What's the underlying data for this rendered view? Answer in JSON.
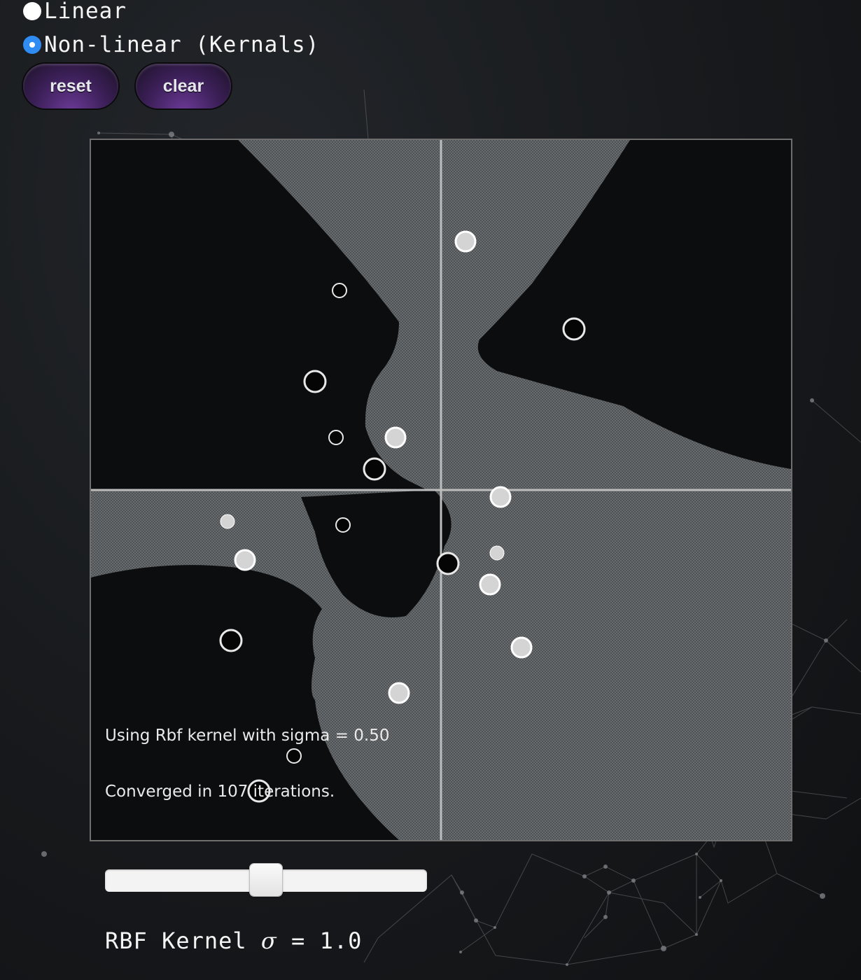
{
  "mode_options": [
    {
      "label": "Linear",
      "selected": false
    },
    {
      "label": "Non-linear (Kernals)",
      "selected": true
    }
  ],
  "buttons": {
    "reset_label": "reset",
    "clear_label": "clear"
  },
  "plot": {
    "kernel_text": "Using Rbf kernel with sigma = 0.50",
    "converged_text": "Converged in 107 iterations.",
    "colors": {
      "region_dark": "#0c0d0f",
      "region_light": "#575a5c",
      "axis": "#bdbdbd",
      "border": "#6e6e6e"
    },
    "points": [
      {
        "x": 0.07,
        "y": 0.71,
        "class": "positive",
        "size": "large"
      },
      {
        "x": -0.29,
        "y": 0.57,
        "class": "negative",
        "size": "small"
      },
      {
        "x": 0.38,
        "y": 0.46,
        "class": "negative",
        "size": "large"
      },
      {
        "x": -0.36,
        "y": 0.31,
        "class": "negative",
        "size": "large"
      },
      {
        "x": -0.3,
        "y": 0.15,
        "class": "negative",
        "size": "small"
      },
      {
        "x": -0.13,
        "y": 0.15,
        "class": "positive",
        "size": "large"
      },
      {
        "x": -0.19,
        "y": 0.06,
        "class": "negative",
        "size": "large"
      },
      {
        "x": 0.17,
        "y": -0.02,
        "class": "positive",
        "size": "large"
      },
      {
        "x": -0.61,
        "y": -0.09,
        "class": "positive",
        "size": "small"
      },
      {
        "x": -0.28,
        "y": -0.1,
        "class": "negative",
        "size": "small"
      },
      {
        "x": 0.16,
        "y": -0.18,
        "class": "positive",
        "size": "small"
      },
      {
        "x": -0.56,
        "y": -0.2,
        "class": "positive",
        "size": "large"
      },
      {
        "x": 0.02,
        "y": -0.21,
        "class": "negative",
        "size": "large"
      },
      {
        "x": 0.14,
        "y": -0.27,
        "class": "positive",
        "size": "large"
      },
      {
        "x": -0.6,
        "y": -0.43,
        "class": "negative",
        "size": "large"
      },
      {
        "x": 0.23,
        "y": -0.45,
        "class": "positive",
        "size": "large"
      },
      {
        "x": -0.12,
        "y": -0.58,
        "class": "positive",
        "size": "large"
      },
      {
        "x": -0.42,
        "y": -0.76,
        "class": "negative",
        "size": "small"
      },
      {
        "x": -0.52,
        "y": -0.86,
        "class": "negative",
        "size": "large"
      }
    ]
  },
  "slider": {
    "value": 0.5,
    "min": 0,
    "max": 1
  },
  "sigma_label": {
    "prefix": "RBF Kernel ",
    "symbol": "σ",
    "suffix": " = 1.0"
  }
}
